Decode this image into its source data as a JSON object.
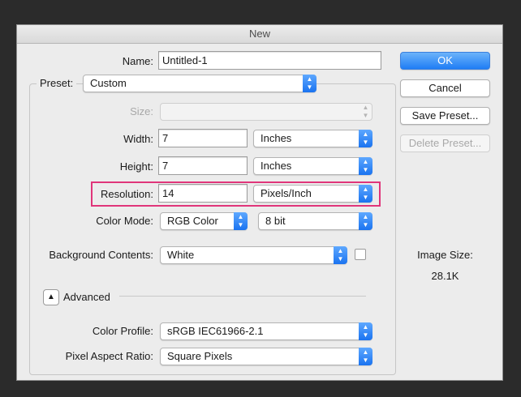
{
  "window": {
    "title": "New"
  },
  "name": {
    "label": "Name:",
    "value": "Untitled-1"
  },
  "preset": {
    "label": "Preset:",
    "value": "Custom"
  },
  "size": {
    "label": "Size:",
    "value": ""
  },
  "width": {
    "label": "Width:",
    "value": "7",
    "unit": "Inches"
  },
  "height": {
    "label": "Height:",
    "value": "7",
    "unit": "Inches"
  },
  "resolution": {
    "label": "Resolution:",
    "value": "14",
    "unit": "Pixels/Inch"
  },
  "color_mode": {
    "label": "Color Mode:",
    "value": "RGB Color",
    "bits": "8 bit"
  },
  "background": {
    "label": "Background Contents:",
    "value": "White"
  },
  "advanced": {
    "label": "Advanced"
  },
  "color_profile": {
    "label": "Color Profile:",
    "value": "sRGB IEC61966-2.1"
  },
  "pixel_aspect": {
    "label": "Pixel Aspect Ratio:",
    "value": "Square Pixels"
  },
  "buttons": {
    "ok": "OK",
    "cancel": "Cancel",
    "save_preset": "Save Preset...",
    "delete_preset": "Delete Preset..."
  },
  "image_size": {
    "label": "Image Size:",
    "value": "28.1K"
  },
  "colors": {
    "accent": "#1f7df5",
    "highlight": "#e0357a"
  }
}
